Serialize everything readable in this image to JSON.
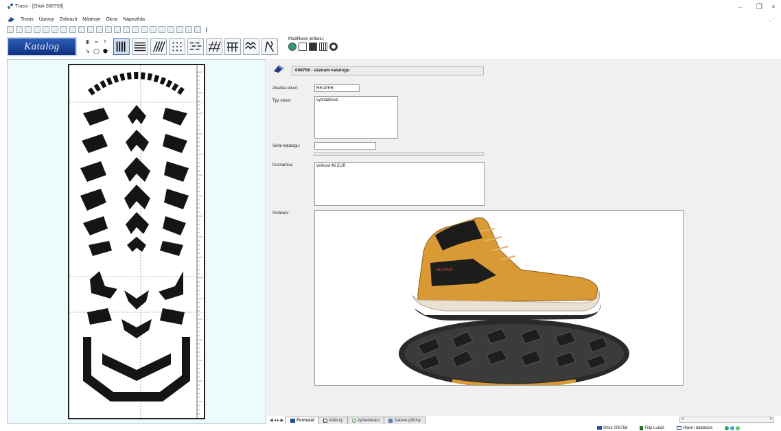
{
  "window": {
    "title": "Trasis - [Otisk 008758]",
    "minimize": "–",
    "restore": "❐",
    "close": "×",
    "mdi_controls": "_ ▫"
  },
  "menu": [
    "Trasis",
    "Úpravy",
    "Zobrazit",
    "Nástroje",
    "Okna",
    "Nápověda"
  ],
  "toolbar": {
    "icons": [
      "new-icon",
      "open-icon",
      "save-icon",
      "db-icon",
      "copy-icon",
      "paste-icon",
      "find-icon",
      "filter-icon",
      "image-icon",
      "print-icon",
      "layers-icon",
      "export-icon",
      "zoom-icon",
      "grid-icon",
      "pen-icon",
      "brush-icon",
      "eraser-icon",
      "measure-icon",
      "compare-icon",
      "stack-icon",
      "chart-icon",
      "window-icon"
    ],
    "info_label": "i"
  },
  "ribbon": {
    "katalog_label": "Katalog",
    "small_buttons": [
      "Ⅲ",
      "≈",
      "ʰ",
      "↘",
      "◯",
      "⬟"
    ],
    "pattern_buttons": [
      "vertical-lines-pattern",
      "horizontal-lines-pattern",
      "diagonal-lines-pattern",
      "dots-pattern",
      "dashes-pattern",
      "crosshatch-pattern",
      "blocks-pattern",
      "zigzag-pattern",
      "wave-pattern"
    ],
    "modifier_label": "Modifikace atributu:"
  },
  "record": {
    "header": "008758  -  záznam katalogu"
  },
  "form": {
    "brand_label": "Značka obuvi:",
    "brand_value": "REAPER",
    "type_label": "Typ obuvi:",
    "type_value": "vycházková",
    "series_label": "Série katalogu:",
    "series_value": "",
    "note_label": "Poznámka:",
    "note_value": "velikost 46 EUR",
    "sole_label": "Podešev:"
  },
  "tabs": {
    "nav": "◀ ◂ ▸ ▶",
    "items": [
      {
        "label": "Formulář",
        "active": true
      },
      {
        "label": "Atributy",
        "active": false
      },
      {
        "label": "Vyhledávání",
        "active": false
      },
      {
        "label": "Datové přílohy",
        "active": false
      }
    ],
    "scroll_left": "<",
    "scroll_right": ">"
  },
  "status": {
    "record": "Otisk 008758",
    "user": "Filip Lukáš",
    "database": "Hlavní databáze"
  },
  "colors": {
    "katalog_bg": "#1b46a0",
    "left_pane_bg": "#eefbfd",
    "shoe_orange": "#d99a36"
  }
}
